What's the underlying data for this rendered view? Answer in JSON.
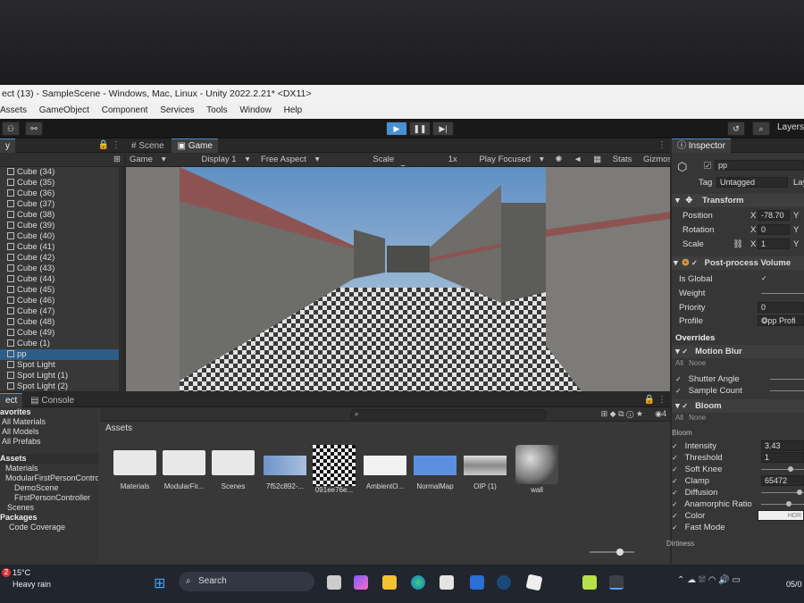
{
  "window": {
    "title": "ect (13) - SampleScene - Windows, Mac, Linux - Unity 2022.2.21* <DX11>"
  },
  "menu": [
    "Assets",
    "GameObject",
    "Component",
    "Services",
    "Tools",
    "Window",
    "Help"
  ],
  "toolbar": {
    "play_icon": "play-icon",
    "pause_icon": "pause-icon",
    "step_icon": "step-icon",
    "layers_label": "Layers"
  },
  "hierarchy": {
    "tab_label": "y",
    "items": [
      "Cube (34)",
      "Cube (35)",
      "Cube (36)",
      "Cube (37)",
      "Cube (38)",
      "Cube (39)",
      "Cube (40)",
      "Cube (41)",
      "Cube (42)",
      "Cube (43)",
      "Cube (44)",
      "Cube (45)",
      "Cube (46)",
      "Cube (47)",
      "Cube (48)",
      "Cube (49)",
      "Cube (1)",
      "pp",
      "Spot Light",
      "Spot Light (1)",
      "Spot Light (2)"
    ],
    "selected": "pp"
  },
  "scene_tab": "Scene",
  "game": {
    "tab": "Game",
    "mode": "Game",
    "display": "Display 1",
    "aspect": "Free Aspect",
    "scale_label": "Scale",
    "scale_value": "1x",
    "play_mode": "Play Focused",
    "stats": "Stats",
    "gizmos": "Gizmos"
  },
  "project": {
    "tab_project": "ect",
    "tab_console": "Console",
    "favorites_header": "avorites",
    "favorites": [
      "All Materials",
      "All Models",
      "All Prefabs"
    ],
    "assets_header": "Assets",
    "tree": [
      "Materials",
      "ModularFirstPersonContro",
      "DemoScene",
      "FirstPersonController",
      "Scenes"
    ],
    "packages_header": "Packages",
    "packages": [
      "Code Coverage"
    ],
    "breadcrumb": "Assets",
    "visibility_count": "4",
    "assets": [
      {
        "name": "Materials",
        "kind": "folder"
      },
      {
        "name": "ModularFir...",
        "kind": "folder"
      },
      {
        "name": "Scenes",
        "kind": "folder"
      },
      {
        "name": "7f52c892-...",
        "kind": "texture-blue"
      },
      {
        "name": "091ee76e...",
        "kind": "checker"
      },
      {
        "name": "AmbientO...",
        "kind": "white"
      },
      {
        "name": "NormalMap",
        "kind": "normal"
      },
      {
        "name": "OIP (1)",
        "kind": "gray"
      },
      {
        "name": "wall",
        "kind": "sphere"
      }
    ]
  },
  "inspector": {
    "tab": "Inspector",
    "object_name": "pp",
    "tag_label": "Tag",
    "tag_value": "Untagged",
    "layer_label": "Lay",
    "transform": {
      "title": "Transform",
      "position_label": "Position",
      "position_x": "-78.70",
      "rotation_label": "Rotation",
      "rotation_x": "0",
      "scale_label": "Scale",
      "scale_x": "1",
      "x_label": "X",
      "y_label": "Y"
    },
    "ppv": {
      "title": "Post-process Volume",
      "is_global": "Is Global",
      "weight": "Weight",
      "priority": "Priority",
      "priority_value": "0",
      "profile": "Profile",
      "profile_value": "pp Profi"
    },
    "overrides": "Overrides",
    "motion_blur": {
      "title": "Motion Blur",
      "all": "All",
      "none": "None",
      "shutter_angle": "Shutter Angle",
      "sample_count": "Sample Count"
    },
    "bloom": {
      "title": "Bloom",
      "all": "All",
      "none": "None",
      "section": "Bloom",
      "intensity": "Intensity",
      "intensity_value": "3.43",
      "threshold": "Threshold",
      "threshold_value": "1",
      "soft_knee": "Soft Knee",
      "clamp": "Clamp",
      "clamp_value": "65472",
      "diffusion": "Diffusion",
      "anamorphic": "Anamorphic Ratio",
      "color": "Color",
      "color_value": "HDR",
      "fast_mode": "Fast Mode",
      "dirtiness": "Dirtiness"
    }
  },
  "taskbar": {
    "badge": "2",
    "temp": "15°C",
    "weather": "Heavy rain",
    "search": "Search",
    "date": "05/0"
  }
}
